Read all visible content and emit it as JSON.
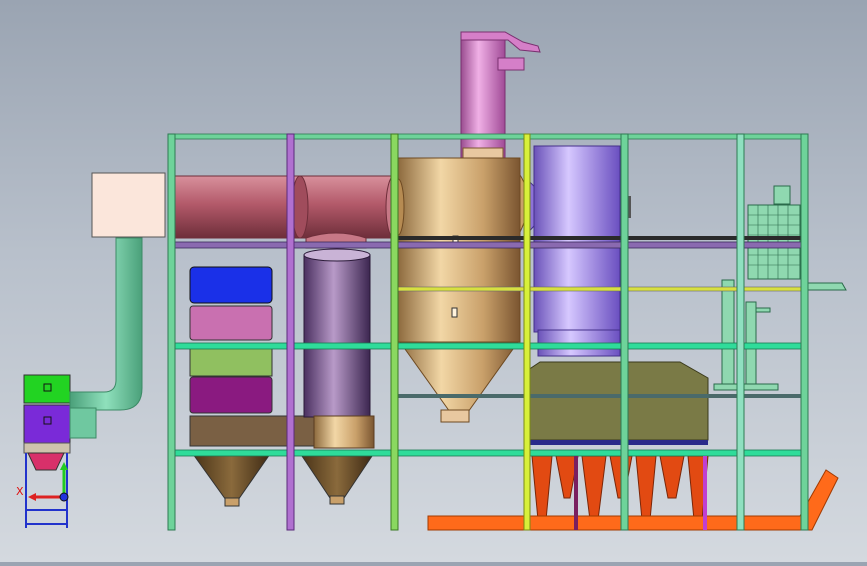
{
  "viewport": {
    "background_top": "#9aa4b2",
    "background_bottom": "#d4d9df"
  },
  "triad": {
    "x_label": "X",
    "x_color": "#dd2222",
    "y_color": "#22cc22",
    "z_color": "#2233dd"
  },
  "colors": {
    "frame_green": "#6ed39a",
    "frame_lime": "#b7ef3a",
    "frame_purple": "#b070d0",
    "duct_red": "#b35a6a",
    "cyclone_tan": "#c9a06a",
    "chimney_pink": "#d57fc8",
    "tank_violet": "#9b7fe0",
    "dryer_olive": "#7a7a46",
    "hopper_orange": "#e24a12",
    "conveyor_orange": "#ff6a1a",
    "filter_blue": "#1a30e8",
    "filter_pink": "#c970b0",
    "filter_green": "#90c060",
    "filter_magenta": "#8a1a80",
    "base_brown": "#7a6044",
    "box_cream": "#fbe6db",
    "pipe_mint": "#6fc8a0"
  }
}
